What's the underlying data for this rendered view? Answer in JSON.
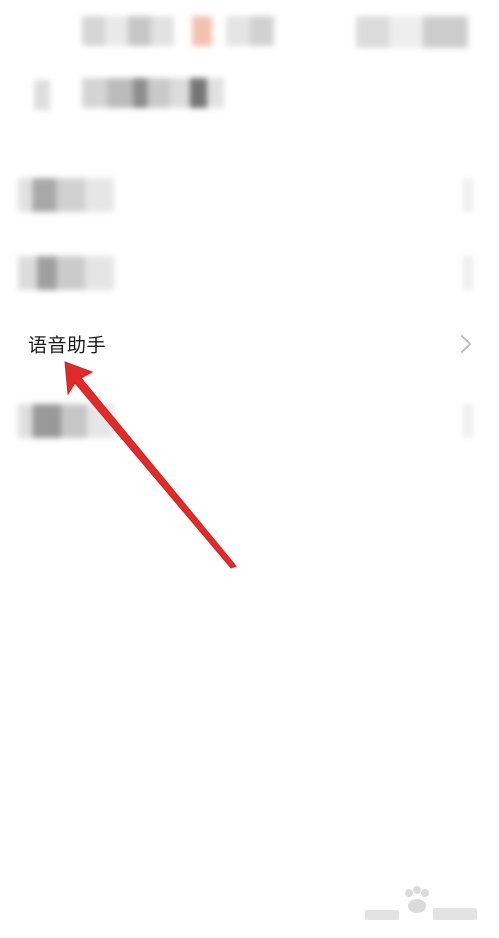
{
  "settings_list": {
    "items": [
      {
        "label": "",
        "redacted": true
      },
      {
        "label": "",
        "redacted": true
      },
      {
        "label": "语音助手",
        "redacted": false
      },
      {
        "label": "",
        "redacted": true
      }
    ]
  },
  "header": {
    "title": "",
    "title_redacted": true
  },
  "icons": {
    "chevron": "chevron-right-icon",
    "arrow": "annotation-arrow-icon"
  },
  "colors": {
    "annotation_red": "#e02b2b",
    "background": "#ffffff"
  }
}
